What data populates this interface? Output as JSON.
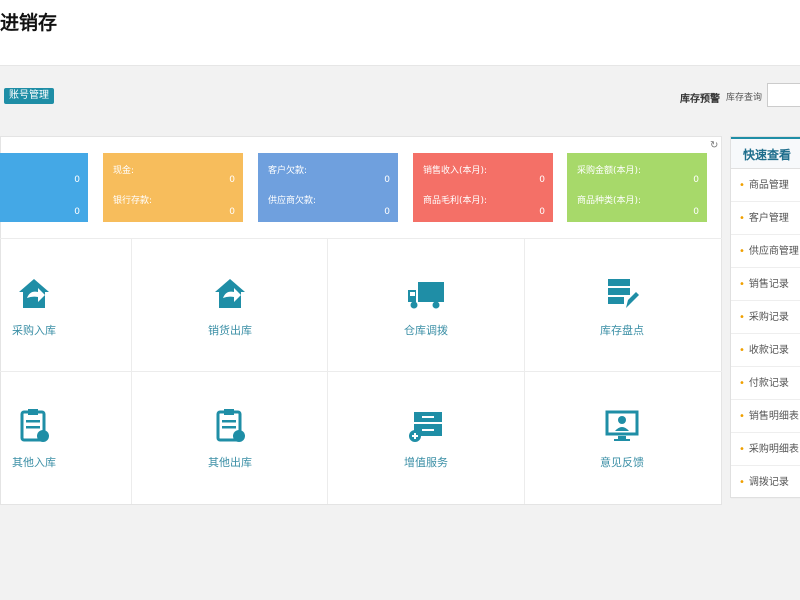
{
  "header": {
    "title": "进销存"
  },
  "toolbar": {
    "badge": "账号管理",
    "link_warning": "库存预警",
    "link_query": "库存查询"
  },
  "cards": [
    {
      "color": "#44a8e6",
      "label1": "",
      "value1": "0",
      "label2": "",
      "value2": "0"
    },
    {
      "color": "#f7bd5c",
      "label1": "现金:",
      "value1": "0",
      "label2": "银行存款:",
      "value2": "0"
    },
    {
      "color": "#6fa0de",
      "label1": "客户欠款:",
      "value1": "0",
      "label2": "供应商欠款:",
      "value2": "0"
    },
    {
      "color": "#f47067",
      "label1": "销售收入(本月):",
      "value1": "0",
      "label2": "商品毛利(本月):",
      "value2": "0"
    },
    {
      "color": "#a7d96a",
      "label1": "采购金额(本月):",
      "value1": "0",
      "label2": "商品种类(本月):",
      "value2": "0"
    }
  ],
  "tiles": [
    {
      "label": "采购入库",
      "icon": "house-arrow-icon"
    },
    {
      "label": "销货出库",
      "icon": "house-arrow-icon"
    },
    {
      "label": "仓库调拨",
      "icon": "truck-icon"
    },
    {
      "label": "库存盘点",
      "icon": "list-pen-icon"
    },
    {
      "label": "其他入库",
      "icon": "clipboard-in-icon"
    },
    {
      "label": "其他出库",
      "icon": "clipboard-out-icon"
    },
    {
      "label": "增值服务",
      "icon": "cabinet-plus-icon"
    },
    {
      "label": "意见反馈",
      "icon": "monitor-user-icon"
    }
  ],
  "quick": {
    "title": "快速查看",
    "items": [
      "商品管理",
      "客户管理",
      "供应商管理",
      "销售记录",
      "采购记录",
      "收款记录",
      "付款记录",
      "销售明细表",
      "采购明细表",
      "调拨记录"
    ]
  },
  "colors": {
    "accent": "#1f8ea6",
    "tile_text": "#3b8fa6",
    "bullet": "#f0a000"
  }
}
